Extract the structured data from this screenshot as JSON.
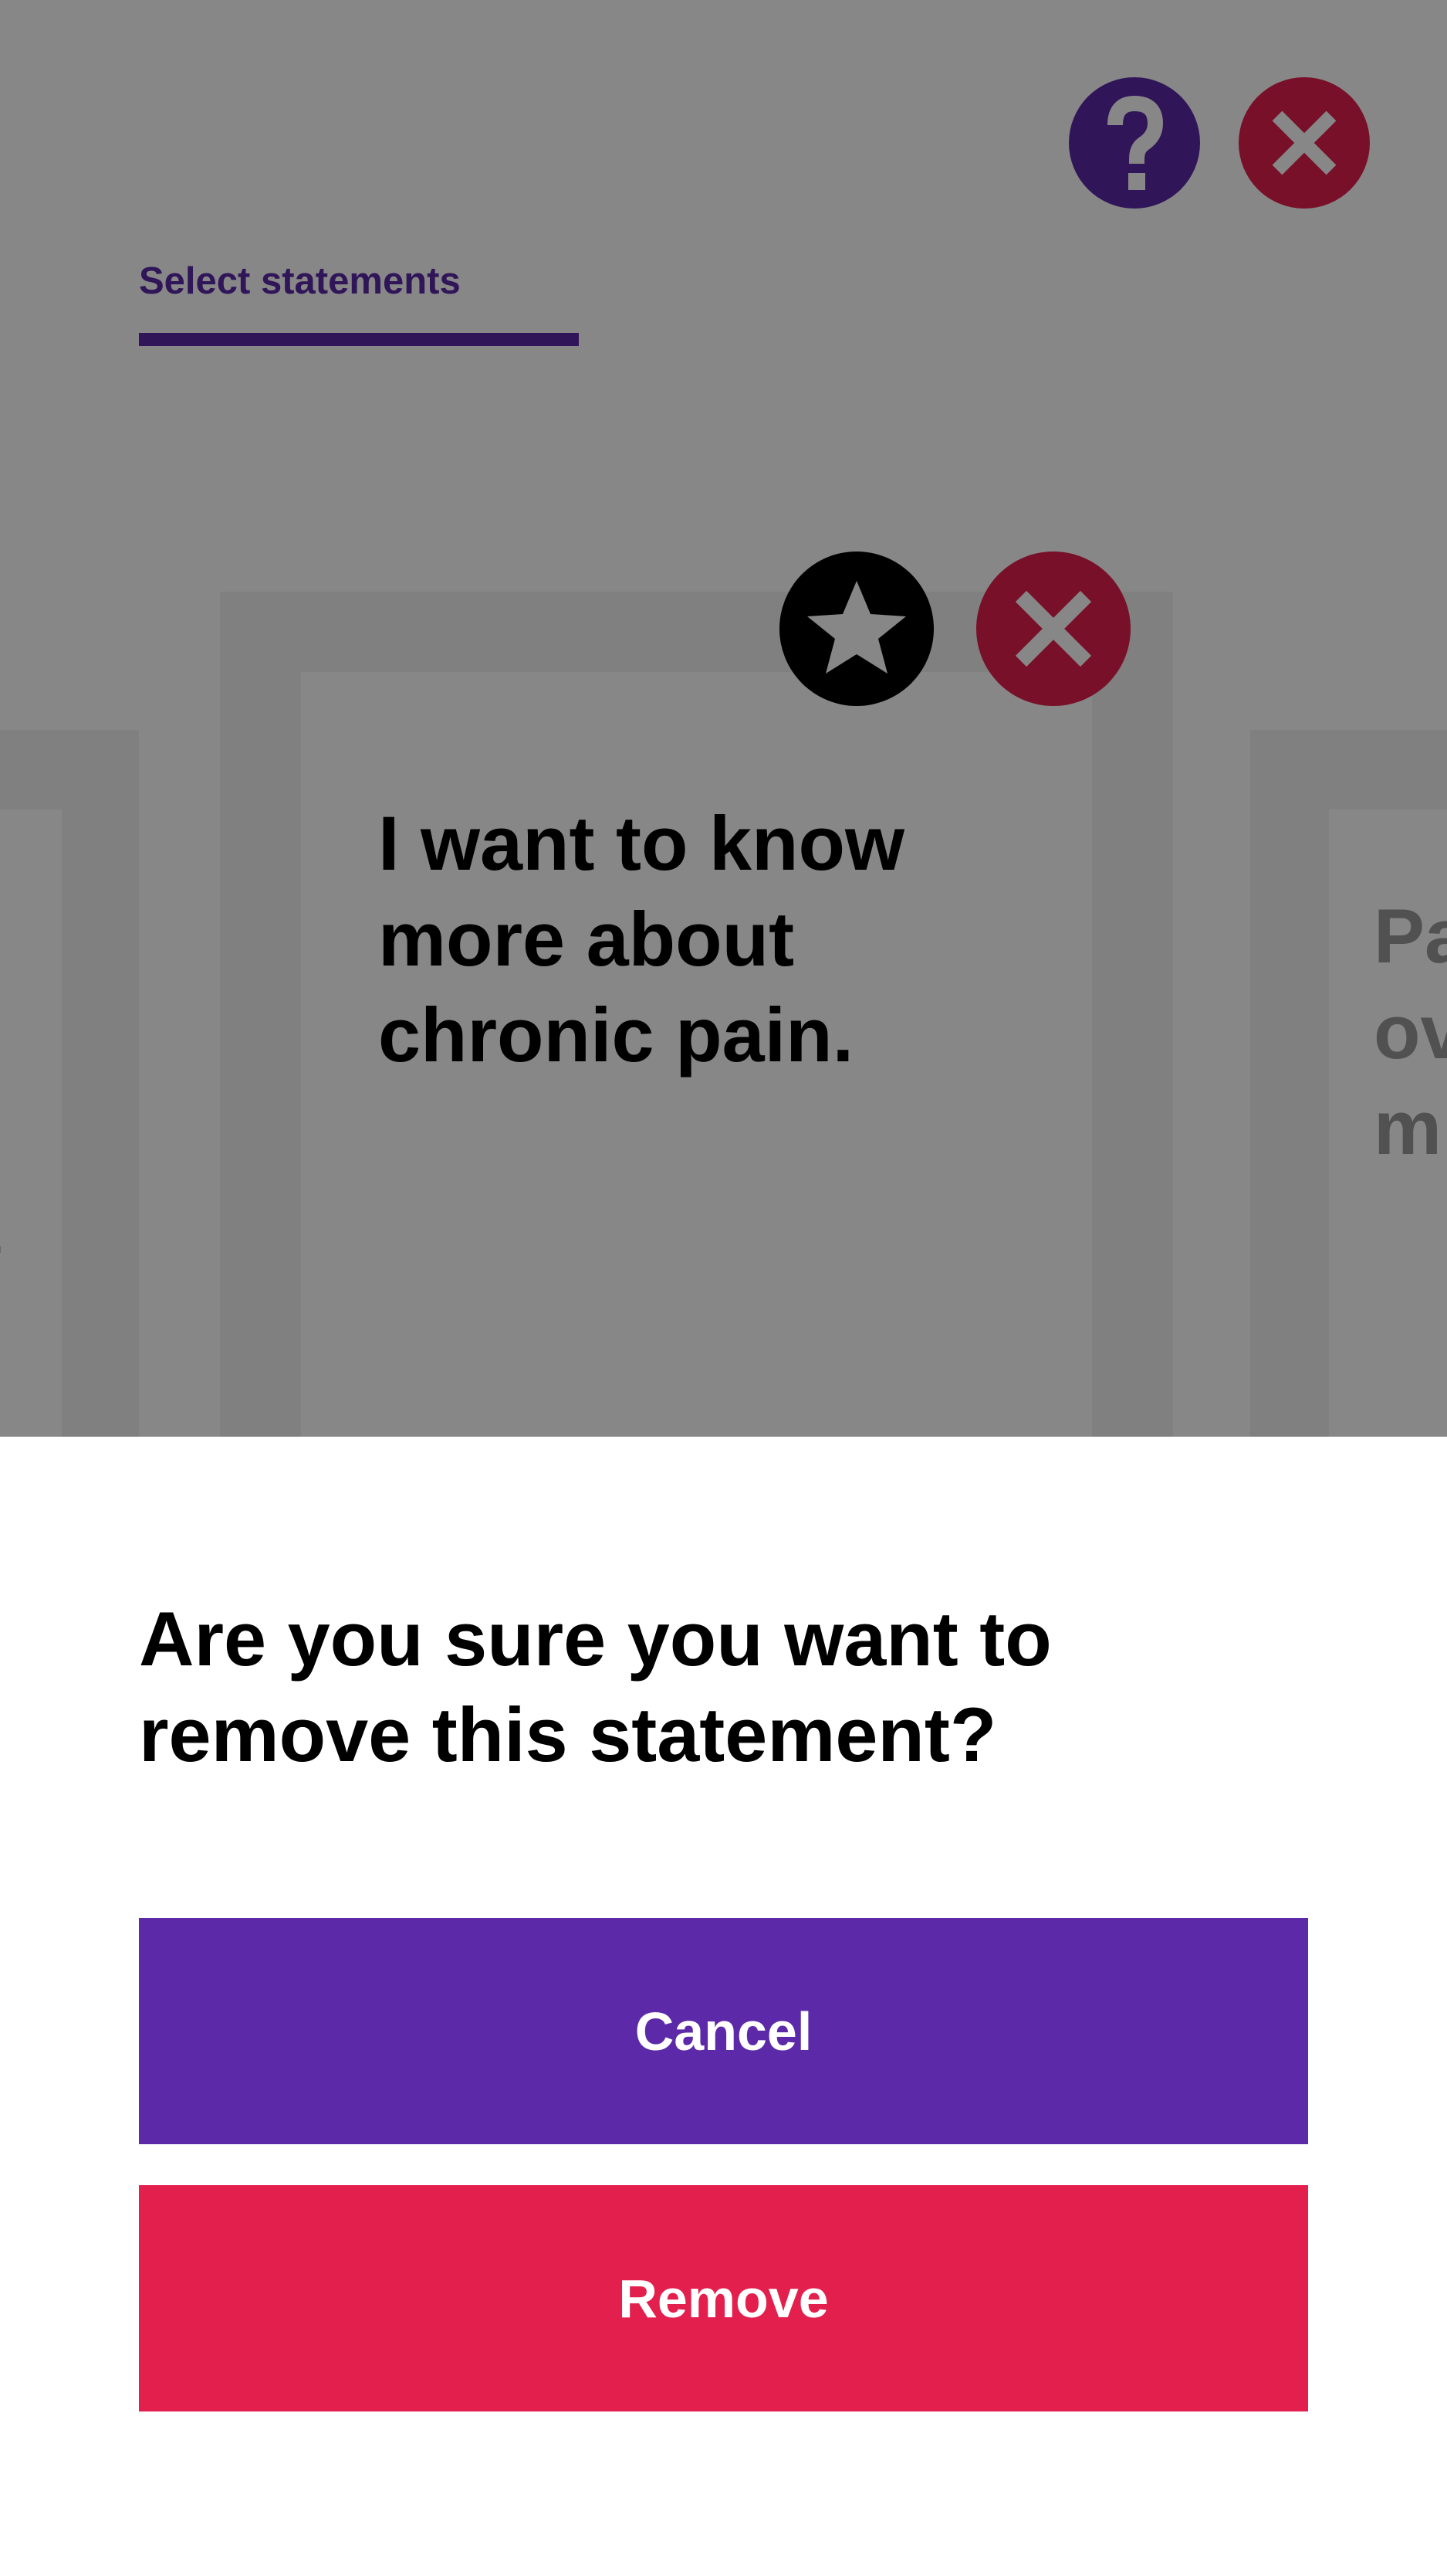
{
  "colors": {
    "accent_purple": "#5C29A8",
    "danger_red": "#E31F4E",
    "scrim": "rgba(0,0,0,0.47)"
  },
  "header": {
    "tab_label": "Select statements",
    "help_icon": "question-mark-icon",
    "close_icon": "close-icon"
  },
  "cards": {
    "current": {
      "text_lines": [
        "I want to know",
        "more about",
        "chronic pain."
      ],
      "favorite_icon": "star-icon",
      "remove_icon": "close-icon"
    },
    "next_partial_lines": [
      "Pa",
      "ov",
      "m"
    ],
    "prev_partial_text": "."
  },
  "dialog": {
    "title_lines": [
      "Are you sure you want to",
      "remove this statement?"
    ],
    "cancel_label": "Cancel",
    "remove_label": "Remove"
  }
}
